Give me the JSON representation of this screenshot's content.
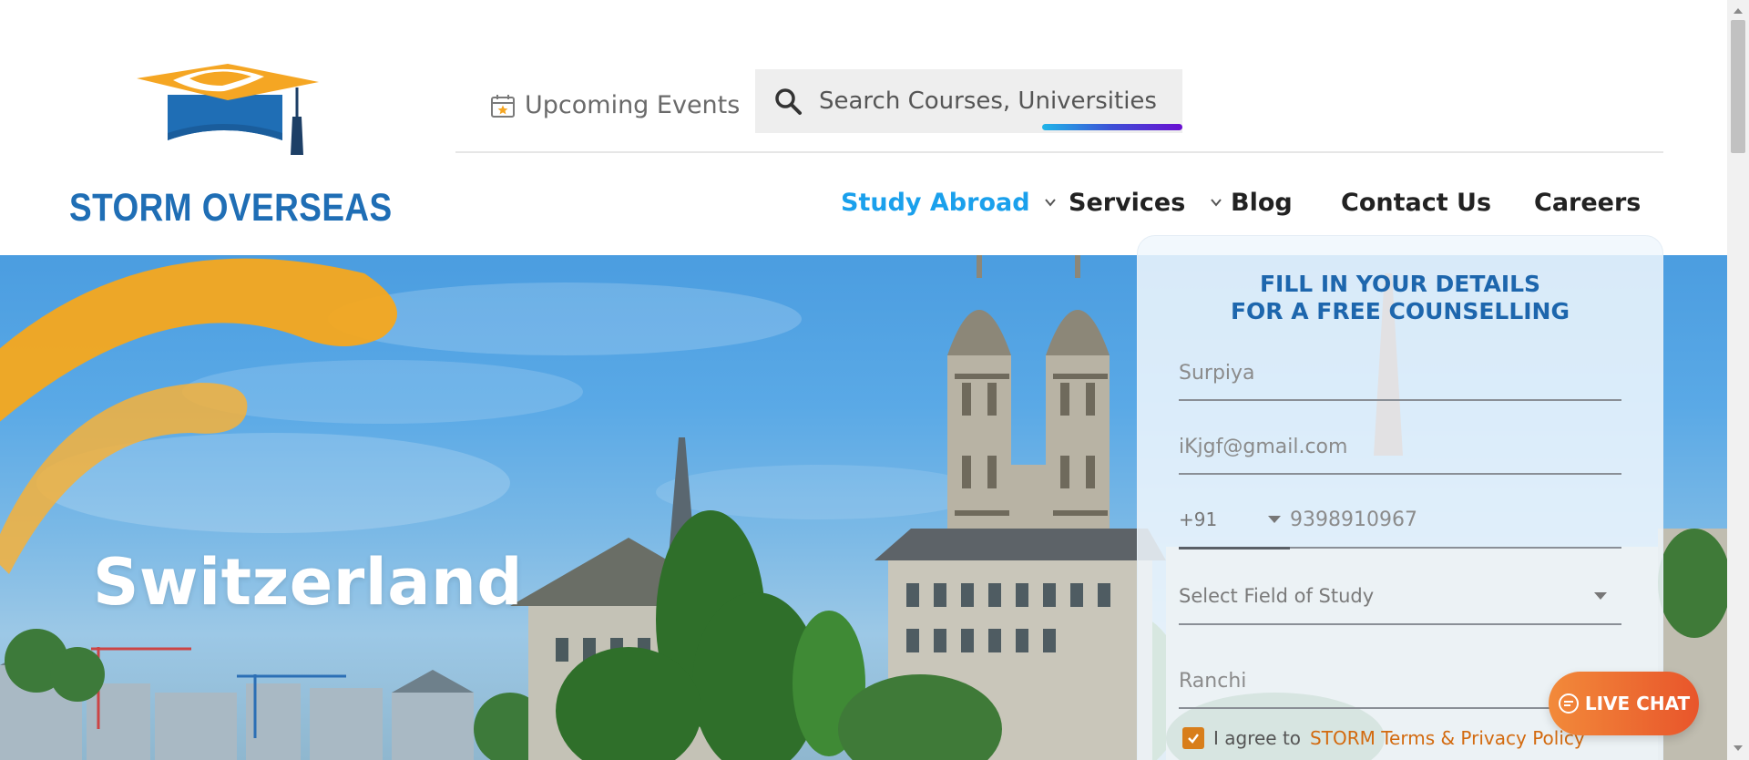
{
  "brand": {
    "name": "STORM OVERSEAS",
    "logo_icon": "graduation-cap-icon",
    "colors": {
      "blue": "#1f6eb5",
      "orange": "#f5a623"
    }
  },
  "header": {
    "upcoming_events": {
      "label": "Upcoming Events",
      "icon": "calendar-star-icon"
    },
    "search": {
      "placeholder": "Search Courses, Universities",
      "icon": "search-icon"
    },
    "nav": [
      {
        "label": "Study Abroad",
        "has_dropdown": true,
        "active": true
      },
      {
        "label": "Services",
        "has_dropdown": true
      },
      {
        "label": "Blog"
      },
      {
        "label": "Contact Us"
      },
      {
        "label": "Careers"
      }
    ]
  },
  "hero": {
    "title": "Switzerland"
  },
  "form": {
    "title_line1": "FILL IN YOUR DETAILS",
    "title_line2": "FOR A FREE COUNSELLING",
    "name_value": "Surpiya",
    "email_value": "iKjgf@gmail.com",
    "phone_code": "+91",
    "phone_value": "9398910967",
    "field_of_study_placeholder": "Select Field of Study",
    "city_value": "Ranchi",
    "agree_checked": true,
    "agree_text": "I agree to",
    "agree_link": "STORM Terms & Privacy Policy"
  },
  "live_chat": {
    "label": "LIVE CHAT",
    "icon": "chat-bubble-icon"
  }
}
